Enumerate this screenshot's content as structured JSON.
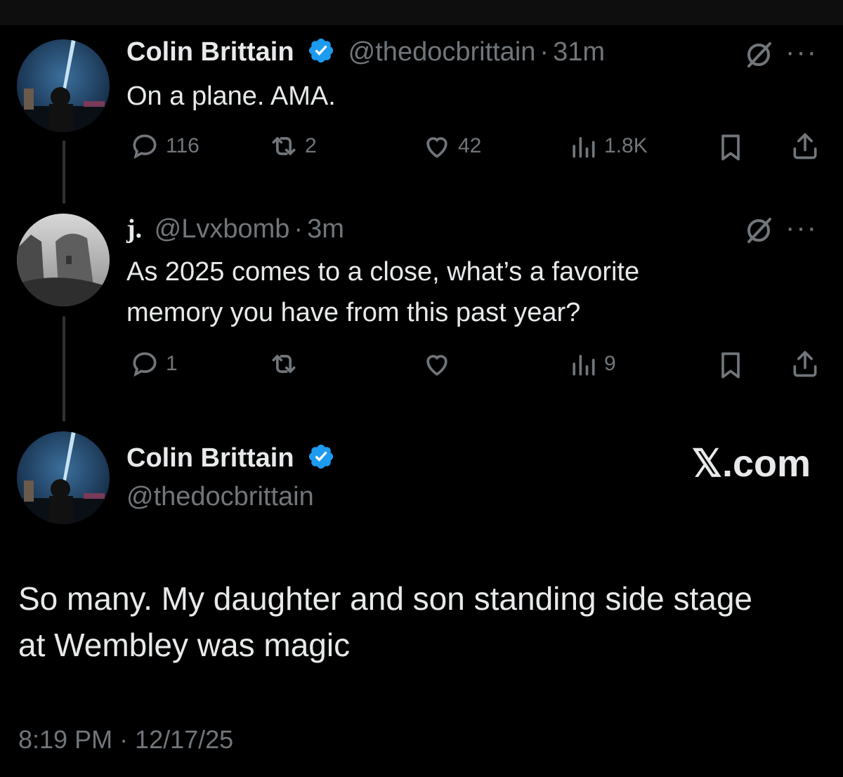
{
  "tweet1": {
    "name": "Colin Brittain",
    "handle": "@thedocbrittain",
    "separator": "·",
    "time": "31m",
    "text": "On a plane.  AMA.",
    "replies": "116",
    "reposts": "2",
    "likes": "42",
    "views": "1.8K"
  },
  "tweet2": {
    "name": "j.",
    "handle": "@Lvxbomb",
    "separator": "·",
    "time": "3m",
    "text_line1": "As 2025 comes to a close, what’s a favorite",
    "text_line2": "memory you have from this past year?",
    "replies": "1",
    "views": "9"
  },
  "main_tweet": {
    "name": "Colin Brittain",
    "handle": "@thedocbrittain",
    "brand": "𝕏.com",
    "text_line1": "So many.  My daughter and son standing side stage",
    "text_line2": "at Wembley was magic",
    "timestamp": "8:19 PM · 12/17/25"
  },
  "icons": {
    "more": "···",
    "reply": "reply-icon",
    "repost": "repost-icon",
    "like": "heart-icon",
    "views": "views-icon",
    "bookmark": "bookmark-icon",
    "share": "share-icon",
    "grok": "grok-icon",
    "verified": "verified-badge-icon"
  },
  "colors": {
    "background": "#000000",
    "text": "#e7e9ea",
    "muted": "#71767b",
    "verified": "#1d9bf0"
  }
}
